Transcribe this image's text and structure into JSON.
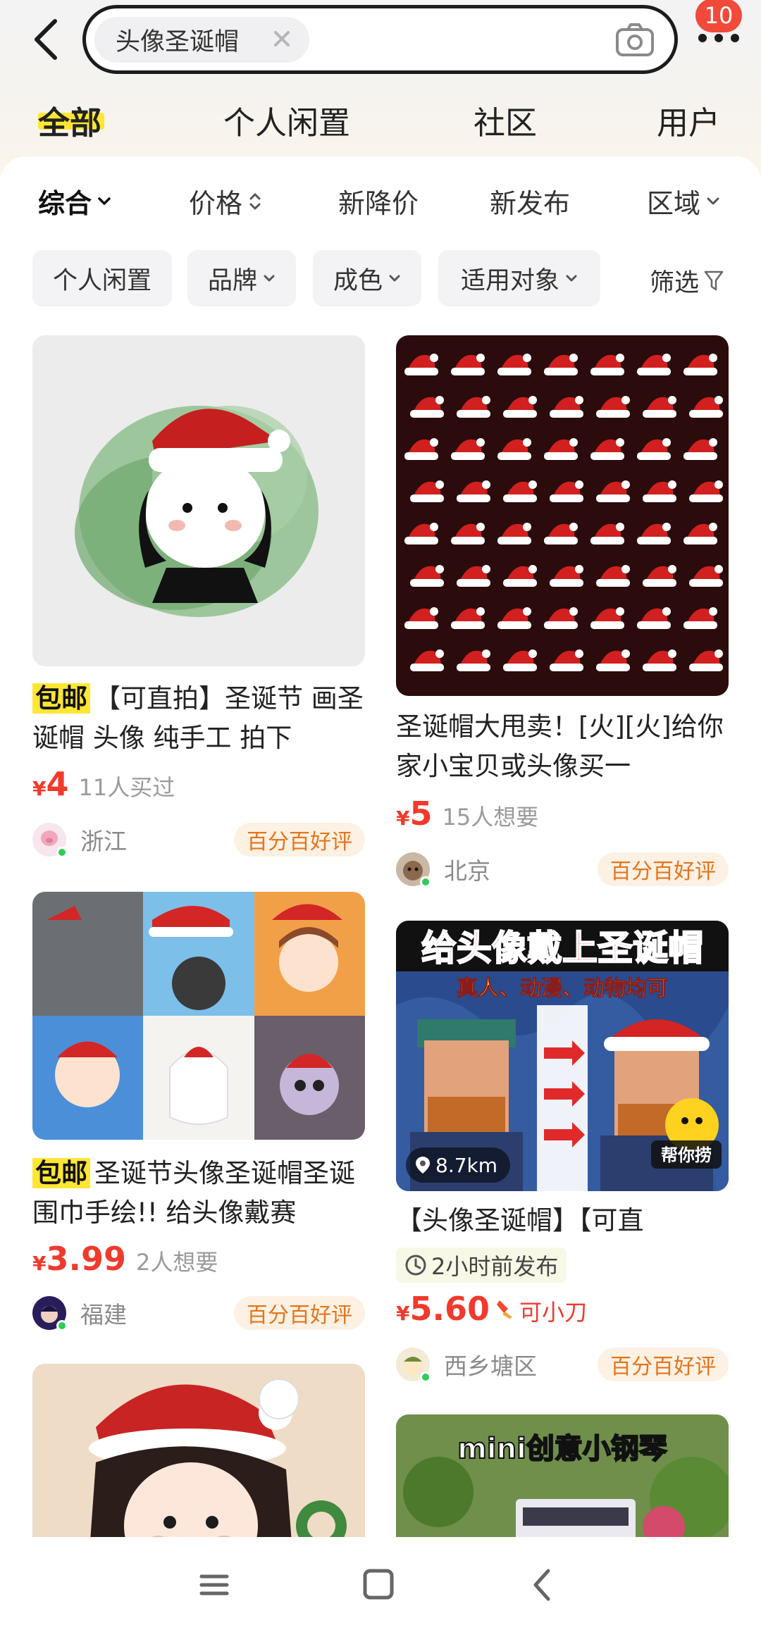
{
  "search": {
    "query": "头像圣诞帽"
  },
  "header": {
    "badge_count": "10"
  },
  "tabs": [
    {
      "label": "全部",
      "active": true
    },
    {
      "label": "个人闲置",
      "active": false
    },
    {
      "label": "社区",
      "active": false
    },
    {
      "label": "用户",
      "active": false
    }
  ],
  "sort": [
    {
      "label": "综合",
      "icon": "chevron-down-icon",
      "active": true
    },
    {
      "label": "价格",
      "icon": "sort-updown-icon",
      "active": false
    },
    {
      "label": "新降价",
      "active": false
    },
    {
      "label": "新发布",
      "active": false
    },
    {
      "label": "区域",
      "icon": "chevron-down-icon",
      "active": false
    }
  ],
  "filters": [
    {
      "label": "个人闲置"
    },
    {
      "label": "品牌",
      "icon": "chevron-down-icon"
    },
    {
      "label": "成色",
      "icon": "chevron-down-icon"
    },
    {
      "label": "适用对象",
      "icon": "chevron-down-icon"
    }
  ],
  "filter_screen": "筛选",
  "products": [
    {
      "tag": "包邮",
      "title": "【可直拍】圣诞节 画圣诞帽 头像 纯手工 拍下",
      "yen": "¥",
      "price": "4",
      "stat": "11人买过",
      "location": "浙江",
      "badge": "百分百好评"
    },
    {
      "title": "圣诞帽大甩卖！[火][火]给你家小宝贝或头像买一",
      "yen": "¥",
      "price": "5",
      "stat": "15人想要",
      "location": "北京",
      "badge": "百分百好评"
    },
    {
      "tag": "包邮",
      "title": "圣诞节头像圣诞帽圣诞围巾手绘!! 给头像戴赛",
      "yen": "¥",
      "price": "3.99",
      "stat": "2人想要",
      "location": "福建",
      "badge": "百分百好评"
    },
    {
      "image_text": {
        "headline": "给头像戴上圣诞帽",
        "sub": "真人、动漫、动物均可",
        "helper": "帮你捞"
      },
      "distance": "8.7km",
      "title": "【头像圣诞帽】【可直",
      "time": "2小时前发布",
      "yen": "¥",
      "price": "5.60",
      "negotiable": "可小刀",
      "location": "西乡塘区",
      "badge": "百分百好评"
    },
    {
      "image_text": {
        "headline": "mini创意小钢琴"
      }
    }
  ],
  "colors": {
    "accent_yellow": "#ffe633",
    "price_red": "#f13a2c",
    "badge_orange": "#e4751c"
  }
}
